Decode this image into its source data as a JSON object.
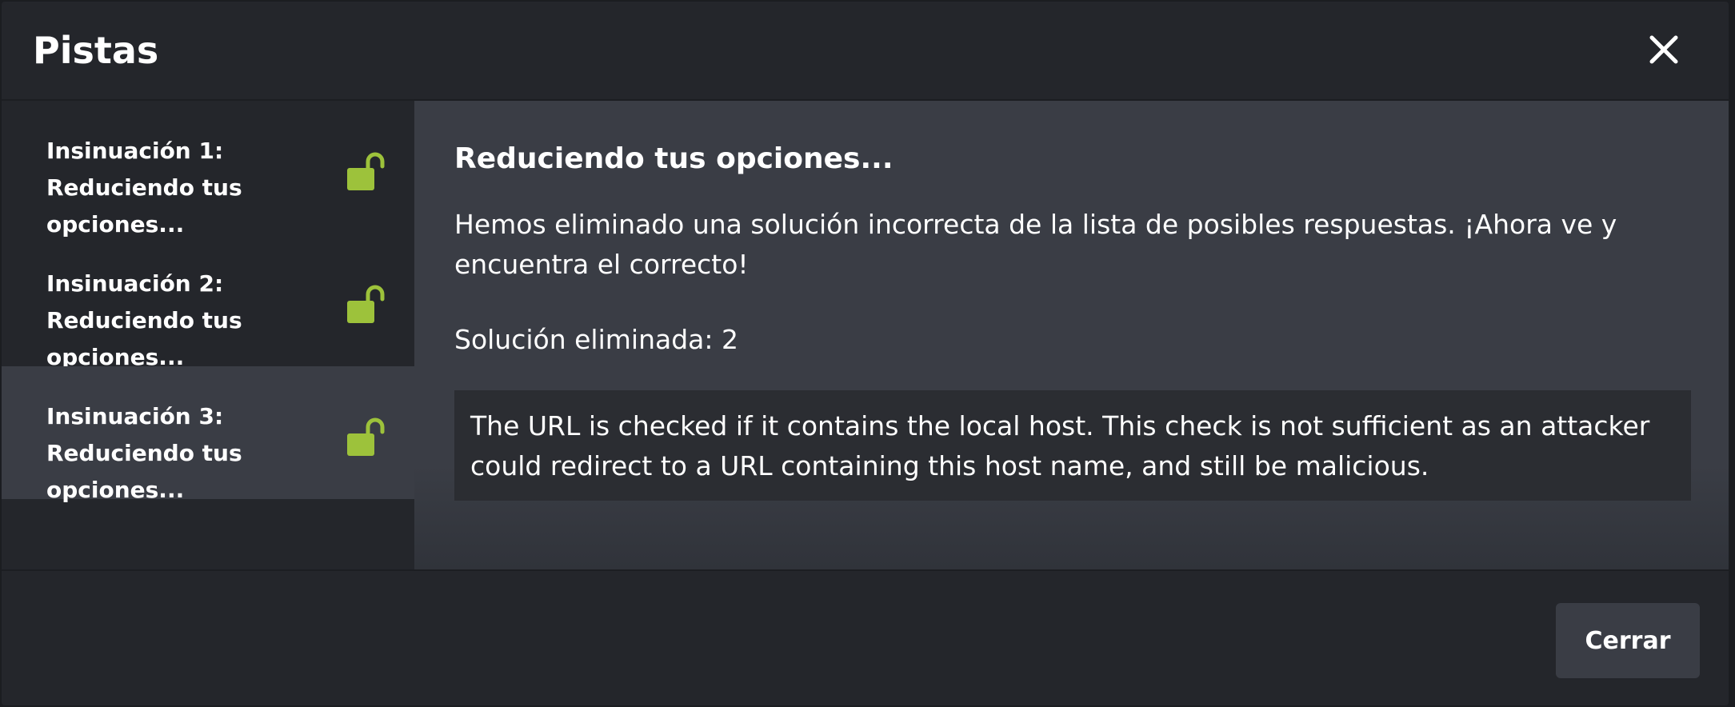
{
  "modal": {
    "title": "Pistas",
    "close_icon": "close-icon"
  },
  "hints": [
    {
      "label": "Insinuación 1: Reduciendo tus opciones...",
      "icon": "unlocked-lock-icon",
      "active": false
    },
    {
      "label": "Insinuación 2: Reduciendo tus opciones...",
      "icon": "unlocked-lock-icon",
      "active": false
    },
    {
      "label": "Insinuación 3: Reduciendo tus opciones...",
      "icon": "unlocked-lock-icon",
      "active": true
    }
  ],
  "content": {
    "heading": "Reduciendo tus opciones...",
    "text": "Hemos eliminado una solución incorrecta de la lista de posibles respuestas. ¡Ahora ve y encuentra el correcto!",
    "removed": "Solución eliminada: 2",
    "hint_box": "The URL is checked if it contains the local host. This check is not sufficient as an attacker could redirect to a URL containing this host name, and still be malicious."
  },
  "footer": {
    "close_label": "Cerrar"
  },
  "colors": {
    "accent_lock": "#9dc23b",
    "modal_bg": "#24262b",
    "content_bg": "#3a3d45",
    "hint_box_bg": "#2b2d32"
  }
}
